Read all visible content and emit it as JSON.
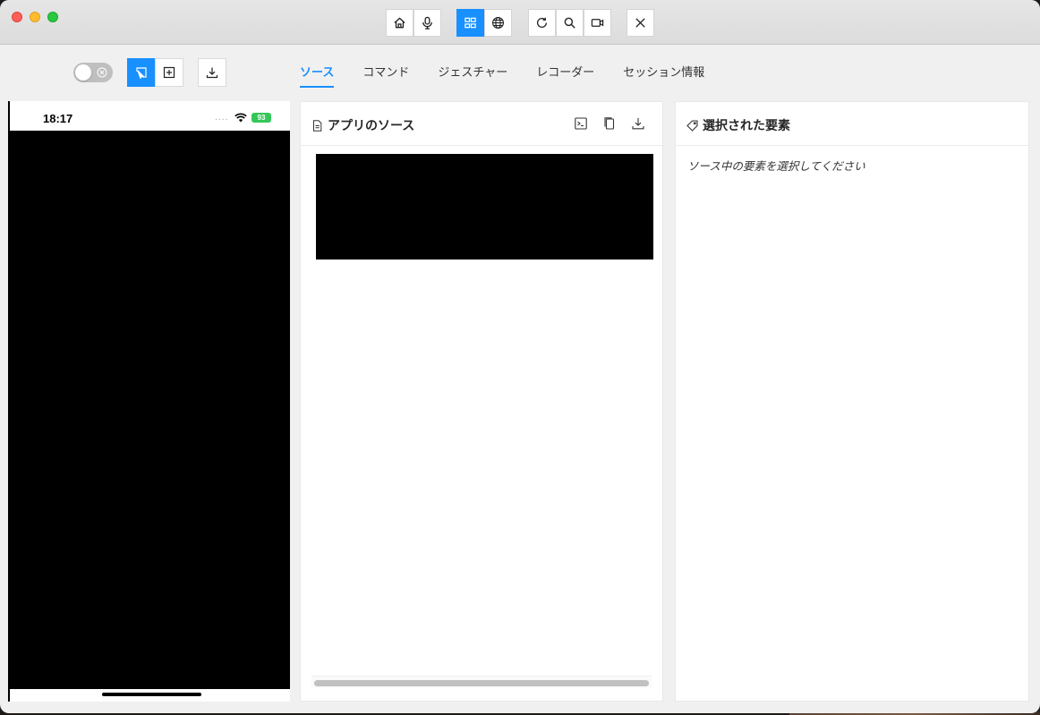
{
  "window": {
    "traffic_lights": [
      "close",
      "minimize",
      "maximize"
    ]
  },
  "title_toolbar": {
    "buttons": [
      {
        "icon": "home-icon",
        "active": false
      },
      {
        "icon": "microphone-icon",
        "active": false
      },
      {
        "icon": "grid-icon",
        "active": true
      },
      {
        "icon": "globe-icon",
        "active": false
      },
      {
        "icon": "refresh-icon",
        "active": false
      },
      {
        "icon": "search-icon",
        "active": false
      },
      {
        "icon": "video-icon",
        "active": false
      },
      {
        "icon": "close-icon",
        "active": false
      }
    ]
  },
  "sub_toolbar": {
    "toggle_on": false,
    "select_mode_icon": "select-element-icon",
    "tap_mode_icon": "tap-coordinates-icon",
    "download_icon": "download-icon"
  },
  "tabs": [
    {
      "label": "ソース",
      "active": true
    },
    {
      "label": "コマンド",
      "active": false
    },
    {
      "label": "ジェスチャー",
      "active": false
    },
    {
      "label": "レコーダー",
      "active": false
    },
    {
      "label": "セッション情報",
      "active": false
    }
  ],
  "device": {
    "time": "18:17",
    "signal": "....",
    "battery": "93"
  },
  "source_panel": {
    "title": "アプリのソース",
    "header_icons": [
      "terminal-icon",
      "copy-icon",
      "download-icon"
    ]
  },
  "element_panel": {
    "title": "選択された要素",
    "placeholder": "ソース中の要素を選択してください"
  },
  "colors": {
    "accent": "#1890ff",
    "battery": "#34c759"
  }
}
